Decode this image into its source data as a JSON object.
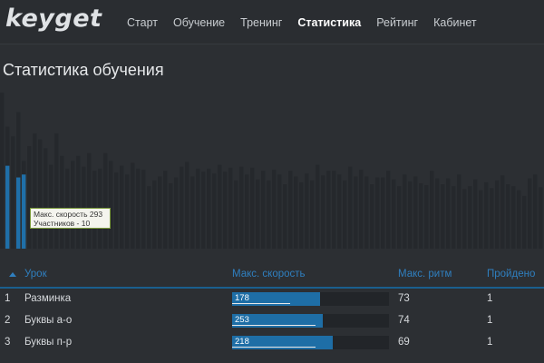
{
  "app": {
    "logo": "keyget"
  },
  "nav": {
    "items": [
      {
        "label": "Старт",
        "active": false
      },
      {
        "label": "Обучение",
        "active": false
      },
      {
        "label": "Тренинг",
        "active": false
      },
      {
        "label": "Статистика",
        "active": true
      },
      {
        "label": "Рейтинг",
        "active": false
      },
      {
        "label": "Кабинет",
        "active": false
      }
    ]
  },
  "page": {
    "title": "Статистика обучения"
  },
  "tooltip": {
    "line1": "Макс. скорость 293",
    "line2": "Участников - 10"
  },
  "chart_data": {
    "type": "bar",
    "title": "",
    "ylim": [
      0,
      160
    ],
    "grid": false,
    "colors": {
      "series": "#25282c",
      "highlight": "#1f6fa8"
    },
    "values": [
      160,
      125,
      115,
      140,
      90,
      105,
      118,
      112,
      103,
      86,
      118,
      95,
      82,
      90,
      95,
      84,
      98,
      80,
      82,
      98,
      90,
      78,
      85,
      76,
      88,
      82,
      81,
      64,
      70,
      74,
      80,
      67,
      73,
      84,
      89,
      74,
      82,
      79,
      82,
      77,
      86,
      79,
      83,
      70,
      84,
      76,
      83,
      71,
      80,
      70,
      81,
      76,
      66,
      80,
      74,
      68,
      77,
      70,
      86,
      75,
      80,
      80,
      76,
      70,
      84,
      74,
      81,
      74,
      66,
      73,
      73,
      80,
      71,
      64,
      76,
      69,
      74,
      67,
      65,
      80,
      72,
      66,
      72,
      64,
      76,
      61,
      64,
      71,
      60,
      68,
      62,
      70,
      75,
      66,
      64,
      60,
      54,
      72,
      76,
      63
    ],
    "highlight": [
      {
        "index": 1,
        "value": 85
      },
      {
        "index": 3,
        "value": 73
      },
      {
        "index": 4,
        "value": 76
      }
    ]
  },
  "table": {
    "headers": {
      "lesson": "Урок",
      "max_speed": "Макс. скорость",
      "max_rhythm": "Макс. ритм",
      "passed": "Пройдено"
    },
    "rows": [
      {
        "num": "1",
        "lesson": "Разминка",
        "speed": "178",
        "speed_fraction": 0.56,
        "rhythm": "73",
        "passed": "1"
      },
      {
        "num": "2",
        "lesson": "Буквы а-о",
        "speed": "253",
        "speed_fraction": 0.58,
        "rhythm": "74",
        "passed": "1"
      },
      {
        "num": "3",
        "lesson": "Буквы п-р",
        "speed": "218",
        "speed_fraction": 0.64,
        "rhythm": "69",
        "passed": "1"
      }
    ]
  }
}
